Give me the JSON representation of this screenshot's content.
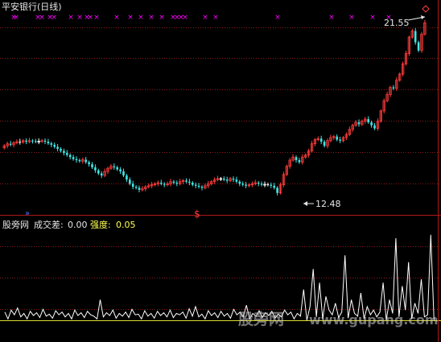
{
  "window": {
    "title": "平安银行(日线)"
  },
  "indicator": {
    "name": "股旁网",
    "label1": "成交差:",
    "value1": "0.00",
    "label2": "强度:",
    "value2": "0.05"
  },
  "annotations": {
    "high": "21.55",
    "low": "12.48",
    "signal": "$",
    "cross_mark": "×"
  },
  "watermark": {
    "text": "股旁网",
    "url": "www.gupang.com"
  },
  "colors": {
    "background": "#000000",
    "up": "#ff3b3b",
    "down": "#3ee6e6",
    "flat": "#ffffff",
    "grid": "#8b1a1a",
    "divider": "#b01818",
    "signal": "#ff00ff",
    "line": "#ffffff",
    "text": "#e6e6e6",
    "strength": "#ffff55"
  },
  "chart_data": [
    {
      "type": "candlestick",
      "title": "平安银行(日线)",
      "price_min": 12.48,
      "price_max": 21.55,
      "n": 135,
      "closes": [
        15.3,
        15.4,
        15.35,
        15.45,
        15.5,
        15.48,
        15.55,
        15.5,
        15.55,
        15.53,
        15.5,
        15.52,
        15.55,
        15.5,
        15.42,
        15.35,
        15.25,
        15.15,
        15.05,
        14.95,
        14.85,
        14.75,
        14.65,
        14.6,
        14.55,
        14.62,
        14.5,
        14.4,
        14.25,
        14.1,
        13.95,
        13.85,
        14.05,
        14.2,
        14.3,
        14.25,
        14.15,
        14.05,
        13.85,
        13.65,
        13.45,
        13.3,
        13.25,
        13.15,
        13.2,
        13.3,
        13.35,
        13.4,
        13.45,
        13.5,
        13.45,
        13.4,
        13.45,
        13.55,
        13.5,
        13.45,
        13.55,
        13.6,
        13.55,
        13.5,
        13.4,
        13.35,
        13.3,
        13.25,
        13.35,
        13.45,
        13.55,
        13.65,
        13.7,
        13.7,
        13.65,
        13.6,
        13.7,
        13.65,
        13.55,
        13.45,
        13.4,
        13.35,
        13.4,
        13.45,
        13.5,
        13.45,
        13.4,
        13.42,
        13.4,
        13.35,
        13.25,
        13.0,
        13.4,
        13.9,
        14.3,
        14.6,
        14.75,
        14.6,
        14.5,
        14.75,
        14.85,
        15.05,
        15.4,
        15.6,
        15.65,
        15.5,
        15.3,
        15.55,
        15.7,
        15.75,
        15.6,
        15.55,
        15.7,
        15.85,
        16.1,
        16.3,
        16.45,
        16.35,
        16.5,
        16.6,
        16.45,
        16.3,
        16.15,
        16.5,
        17.0,
        17.5,
        17.8,
        18.15,
        18.1,
        18.5,
        18.8,
        19.3,
        19.8,
        20.6,
        20.9,
        20.35,
        19.95,
        20.75,
        21.3
      ]
    },
    {
      "type": "line",
      "title": "股旁网",
      "series": [
        {
          "name": "成交差",
          "values": [
            0.12,
            0.02,
            0.15,
            0.08,
            0.18,
            0.05,
            0.1,
            0.02,
            0.13,
            0.07,
            0.11,
            0.04,
            0.16,
            0.06,
            0.09,
            0.03,
            0.14,
            0.08,
            0.12,
            0.05,
            0.1,
            0.02,
            0.15,
            0.07,
            0.11,
            0.04,
            0.13,
            0.08,
            0.06,
            0.02,
            0.3,
            0.05,
            0.11,
            0.07,
            0.15,
            0.03,
            0.1,
            0.06,
            0.12,
            0.04,
            0.16,
            0.08,
            0.09,
            0.02,
            0.14,
            0.06,
            0.1,
            0.03,
            0.13,
            0.07,
            0.11,
            0.05,
            0.15,
            0.04,
            0.1,
            0.08,
            0.12,
            0.03,
            0.17,
            0.06,
            0.2,
            0.05,
            0.09,
            0.02,
            0.14,
            0.07,
            0.11,
            0.04,
            0.13,
            0.06,
            0.1,
            0.03,
            0.16,
            0.08,
            0.12,
            0.05,
            0.22,
            0.02,
            0.1,
            0.06,
            0.14,
            0.04,
            0.11,
            0.07,
            0.13,
            0.03,
            0.09,
            0.05,
            0.15,
            0.08,
            0.12,
            0.02,
            0.1,
            0.06,
            0.45,
            0.0,
            0.2,
            0.75,
            0.05,
            0.55,
            0.02,
            0.35,
            0.15,
            0.08,
            0.25,
            0.04,
            0.12,
            0.95,
            0.03,
            0.3,
            0.1,
            0.06,
            0.4,
            0.02,
            0.2,
            0.08,
            0.15,
            0.05,
            0.12,
            0.55,
            0.0,
            0.3,
            0.1,
            1.2,
            0.05,
            0.5,
            0.15,
            0.85,
            0.02,
            0.25,
            0.1,
            0.6,
            0.05,
            0.08,
            1.25,
            0.0
          ]
        }
      ]
    }
  ]
}
